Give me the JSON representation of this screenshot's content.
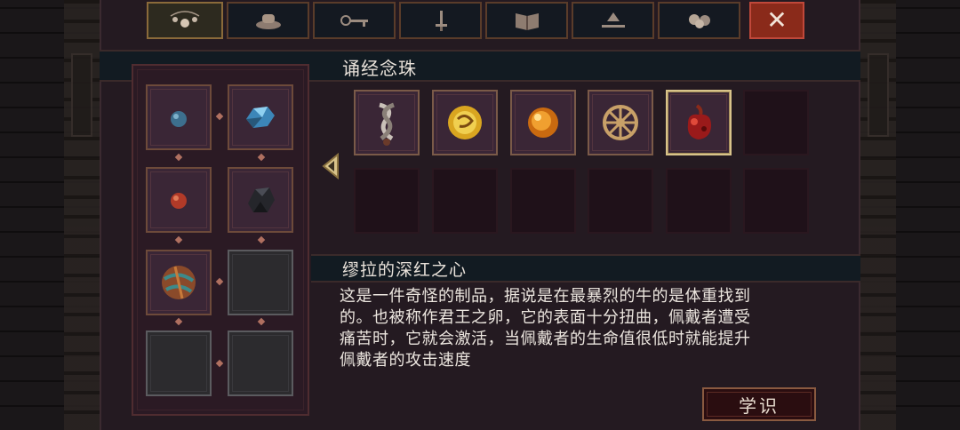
{
  "tabs": [
    {
      "icon": "beads-icon"
    },
    {
      "icon": "cloth-icon"
    },
    {
      "icon": "key-icon"
    },
    {
      "icon": "sword-icon"
    },
    {
      "icon": "book-icon"
    },
    {
      "icon": "altar-icon"
    },
    {
      "icon": "skulls-icon"
    }
  ],
  "close_label": "✕",
  "section_title": "诵经念珠",
  "item_name": "缪拉的深红之心",
  "item_description": [
    "这是一件奇怪的制品，据说是在最暴烈的牛的是体重找到",
    "的。也被称作君王之卵，它的表面十分扭曲，佩戴者遭受",
    "痛苦时，它就会激活，当佩戴者的生命值很低时就能提升",
    "佩戴者的攻击速度"
  ],
  "learn_button": "学识",
  "colors": {
    "panel": "#241a21",
    "header_bar": "#121b22",
    "accent_gold": "#d8c38a",
    "close_red": "#8a2a1a"
  },
  "equipped_beads": [
    {
      "icon": "blue-bead-icon"
    },
    {
      "icon": "blue-crystal-icon"
    },
    {
      "icon": "red-bead-icon"
    },
    {
      "icon": "dark-stone-icon"
    },
    {
      "icon": "patterned-orb-icon"
    },
    {
      "icon": "empty-slot"
    },
    {
      "icon": "empty-slot"
    },
    {
      "icon": "empty-slot"
    }
  ],
  "bead_grid": [
    {
      "icon": "knotted-bead-icon"
    },
    {
      "icon": "gold-coin-icon"
    },
    {
      "icon": "amber-orb-icon"
    },
    {
      "icon": "wheel-bead-icon"
    },
    {
      "icon": "crimson-heart-icon"
    },
    {
      "icon": "empty-slot"
    },
    {
      "icon": "empty-slot"
    },
    {
      "icon": "empty-slot"
    },
    {
      "icon": "empty-slot"
    },
    {
      "icon": "empty-slot"
    },
    {
      "icon": "empty-slot"
    },
    {
      "icon": "empty-slot"
    }
  ],
  "selected_index": 4
}
